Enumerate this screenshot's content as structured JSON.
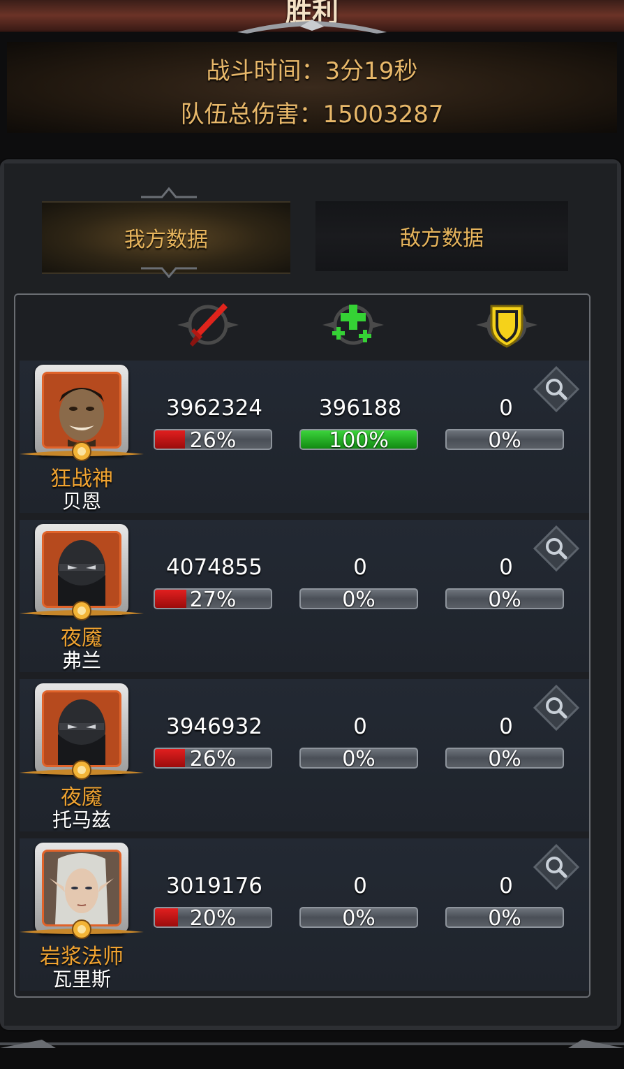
{
  "title": "胜利",
  "summary": {
    "time_label": "战斗时间：3分19秒",
    "damage_label": "队伍总伤害：15003287"
  },
  "tabs": {
    "mine": "我方数据",
    "enemy": "敌方数据"
  },
  "columns": {
    "damage_icon": "sword-icon",
    "heal_icon": "heal-cross-icon",
    "defense_icon": "shield-icon"
  },
  "colors": {
    "damage_bar": "#d31818",
    "heal_bar": "#2fc42f",
    "class_text": "#f0a330",
    "summary_text": "#e8b86a"
  },
  "heroes": [
    {
      "class": "狂战神",
      "name": "贝恩",
      "portrait": "orc-warrior-portrait",
      "damage": "3962324",
      "damage_pct": "26%",
      "damage_fraction": 0.26,
      "heal": "396188",
      "heal_pct": "100%",
      "heal_fraction": 1.0,
      "defense": "0",
      "defense_pct": "0%"
    },
    {
      "class": "夜魇",
      "name": "弗兰",
      "portrait": "masked-ninja-portrait",
      "damage": "4074855",
      "damage_pct": "27%",
      "damage_fraction": 0.27,
      "heal": "0",
      "heal_pct": "0%",
      "heal_fraction": 0,
      "defense": "0",
      "defense_pct": "0%"
    },
    {
      "class": "夜魇",
      "name": "托马兹",
      "portrait": "masked-ninja-portrait",
      "damage": "3946932",
      "damage_pct": "26%",
      "damage_fraction": 0.26,
      "heal": "0",
      "heal_pct": "0%",
      "heal_fraction": 0,
      "defense": "0",
      "defense_pct": "0%"
    },
    {
      "class": "岩浆法师",
      "name": "瓦里斯",
      "portrait": "elf-mage-portrait",
      "damage": "3019176",
      "damage_pct": "20%",
      "damage_fraction": 0.2,
      "heal": "0",
      "heal_pct": "0%",
      "heal_fraction": 0,
      "defense": "0",
      "defense_pct": "0%"
    }
  ]
}
